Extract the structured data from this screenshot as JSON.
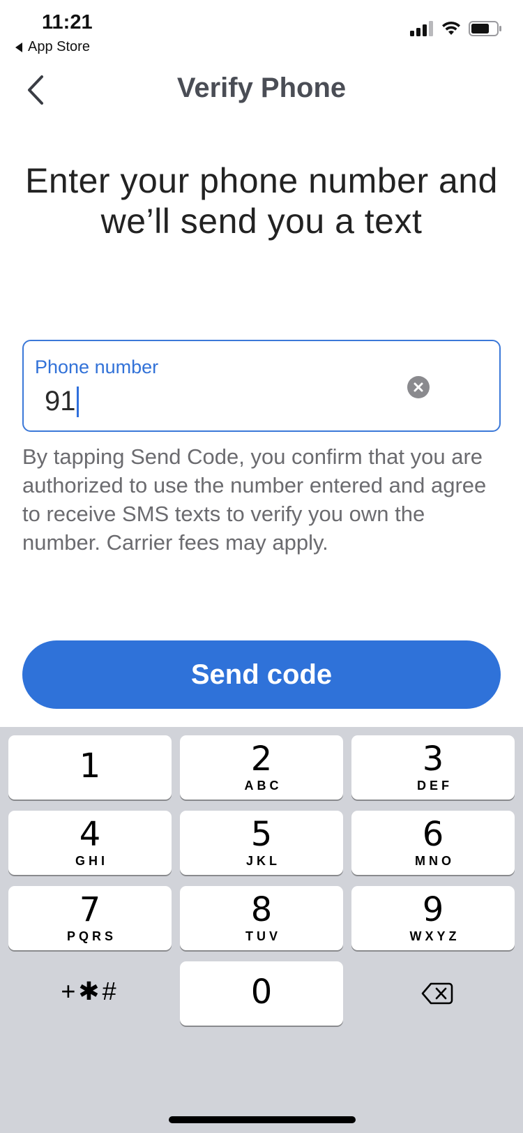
{
  "status_bar": {
    "time": "11:21",
    "back_app_label": "App Store"
  },
  "nav": {
    "title": "Verify Phone"
  },
  "headline": {
    "line1": "Enter your phone number and",
    "line2": "we’ll send you a text"
  },
  "phone_input": {
    "label": "Phone number",
    "value": "91"
  },
  "disclaimer": "By tapping Send Code, you confirm that you are authorized to use the number entered and agree to receive SMS texts to verify you own the number. Carrier fees may apply.",
  "send_button": {
    "label": "Send code"
  },
  "colors": {
    "accent": "#2f72d9",
    "keyboard_bg": "#d1d3d9"
  },
  "keypad": {
    "keys": [
      {
        "num": "1",
        "letters": ""
      },
      {
        "num": "2",
        "letters": "ABC"
      },
      {
        "num": "3",
        "letters": "DEF"
      },
      {
        "num": "4",
        "letters": "GHI"
      },
      {
        "num": "5",
        "letters": "JKL"
      },
      {
        "num": "6",
        "letters": "MNO"
      },
      {
        "num": "7",
        "letters": "PQRS"
      },
      {
        "num": "8",
        "letters": "TUV"
      },
      {
        "num": "9",
        "letters": "WXYZ"
      },
      {
        "num": "0",
        "letters": ""
      }
    ],
    "symbols": "+✱#"
  }
}
